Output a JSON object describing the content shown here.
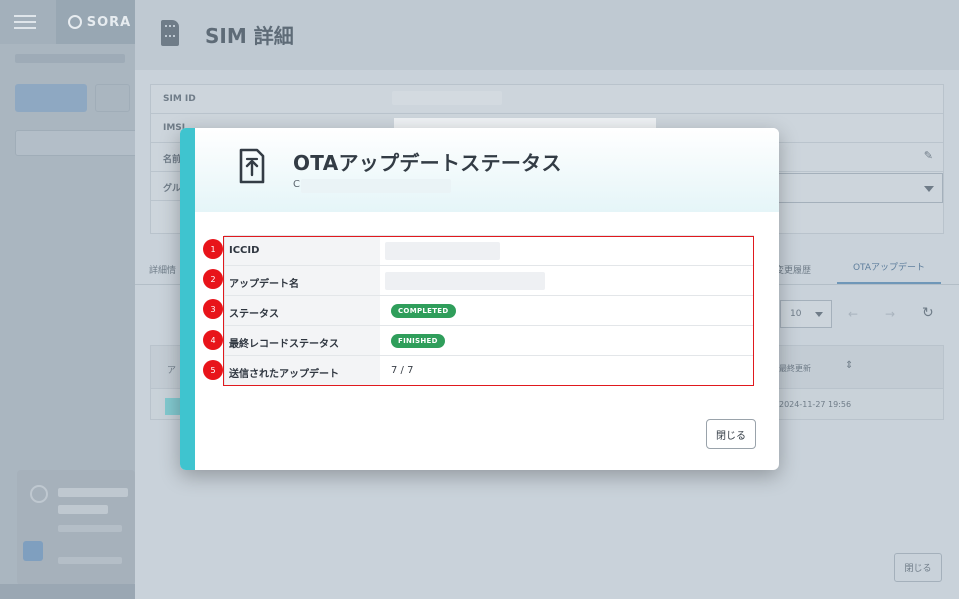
{
  "background": {
    "brand_logo_text": "SORA",
    "page_title": "SIM 詳細",
    "panel_labels": [
      "SIM ID",
      "IMSI",
      "名前",
      "グル"
    ],
    "tabs": {
      "left": "詳細情",
      "history": "変更履歴",
      "ota": "OTAアップデート"
    },
    "page_size": "10",
    "table_header_left": "ア",
    "table_header_updated": "最終更新",
    "table_row_updated": "2024-11-27 19:56",
    "bottom_close_label": "閉じる"
  },
  "modal": {
    "title": "OTAアップデートステータス",
    "subtitle_prefix": "C",
    "rows": [
      {
        "num": "1",
        "label": "ICCID",
        "value": ""
      },
      {
        "num": "2",
        "label": "アップデート名",
        "value": ""
      },
      {
        "num": "3",
        "label": "ステータス",
        "badge": "COMPLETED"
      },
      {
        "num": "4",
        "label": "最終レコードステータス",
        "badge": "FINISHED"
      },
      {
        "num": "5",
        "label": "送信されたアップデート",
        "value": "7 / 7"
      }
    ],
    "close_label": "閉じる"
  },
  "colors": {
    "accent": "#3fc4cf",
    "badge_green": "#2f9e5b",
    "annotation_red": "#e0191e"
  },
  "icons": {
    "menu": "hamburger-icon",
    "sim": "sim-card-icon",
    "ota": "upload-arrow-icon",
    "edit": "pencil-icon",
    "refresh": "refresh-icon"
  }
}
